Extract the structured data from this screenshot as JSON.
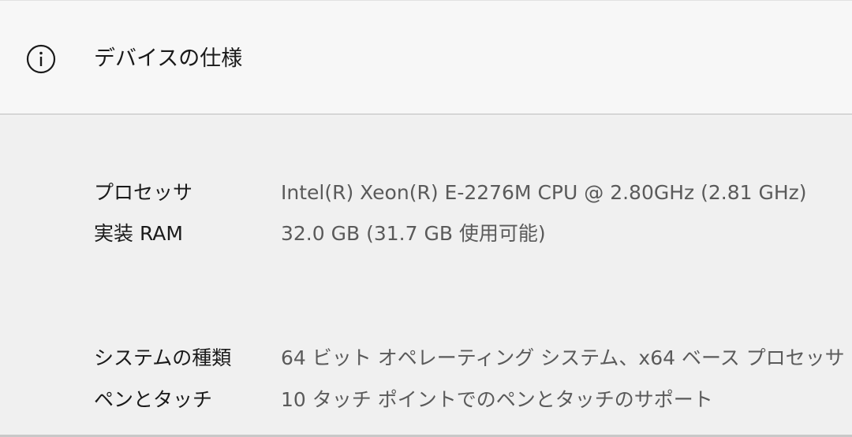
{
  "header": {
    "icon": "info-icon",
    "title": "デバイスの仕様"
  },
  "specs": [
    {
      "label": "プロセッサ",
      "value": "Intel(R) Xeon(R) E-2276M  CPU @ 2.80GHz (2.81 GHz)"
    },
    {
      "label": "実装 RAM",
      "value": "32.0 GB (31.7 GB 使用可能)"
    },
    {
      "label": "システムの種類",
      "value": "64 ビット オペレーティング システム、x64 ベース プロセッサ"
    },
    {
      "label": "ペンとタッチ",
      "value": "10 タッチ ポイントでのペンとタッチのサポート"
    }
  ]
}
